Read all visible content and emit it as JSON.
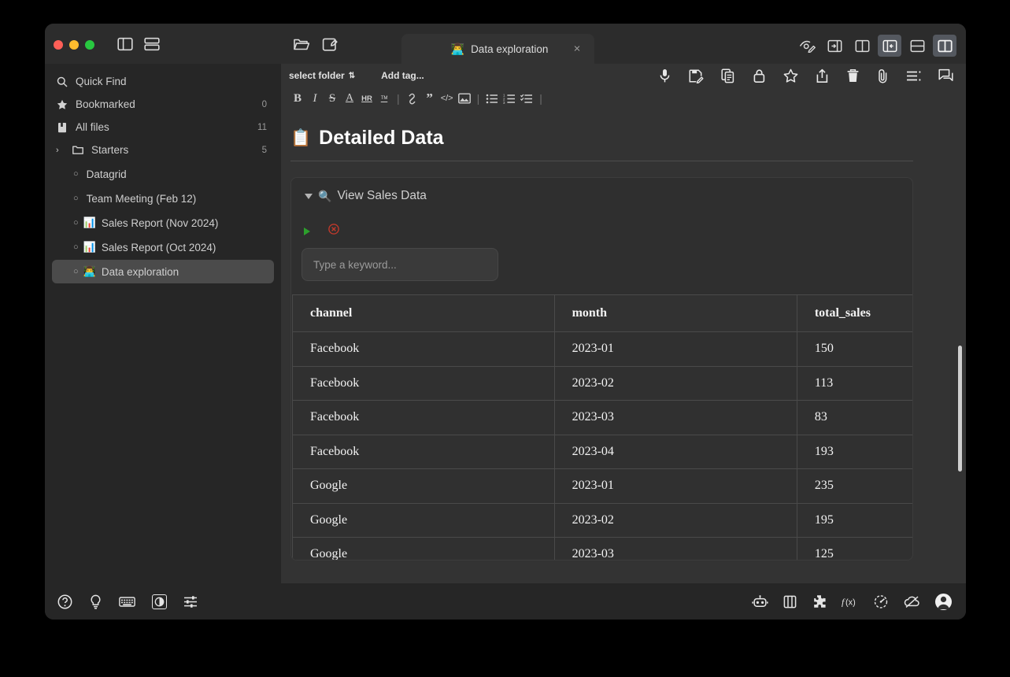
{
  "window": {
    "traffic_lights": [
      "close",
      "minimize",
      "maximize"
    ],
    "left_icons": [
      "sidebar-toggle-icon",
      "split-view-icon"
    ],
    "open_icons": [
      "open-folder-icon",
      "new-note-icon"
    ],
    "right_icons": [
      "preview-edit-icon",
      "focus-pane-icon",
      "dual-pane-icon",
      "left-pane-icon",
      "stacked-pane-icon",
      "side-pane-icon"
    ],
    "right_icons_active": [
      3,
      5
    ]
  },
  "tab": {
    "emoji": "👨‍💻",
    "title": "Data exploration",
    "close_label": "×"
  },
  "sidebar": {
    "quick_find": {
      "label": "Quick Find",
      "icon": "search-icon"
    },
    "bookmarked": {
      "label": "Bookmarked",
      "count": "0",
      "icon": "star-icon"
    },
    "all_files": {
      "label": "All files",
      "count": "11",
      "icon": "book-icon"
    },
    "folder": {
      "label": "Starters",
      "count": "5",
      "icon": "folder-icon",
      "chevron": "›"
    },
    "files": [
      {
        "bullet": "○",
        "emoji": "",
        "label": "Datagrid",
        "selected": false
      },
      {
        "bullet": "○",
        "emoji": "",
        "label": "Team Meeting (Feb 12)",
        "selected": false
      },
      {
        "bullet": "○",
        "emoji": "📊",
        "label": "Sales Report (Nov 2024)",
        "selected": false
      },
      {
        "bullet": "○",
        "emoji": "📊",
        "label": "Sales Report (Oct 2024)",
        "selected": false
      },
      {
        "bullet": "○",
        "emoji": "👨‍💻",
        "label": "Data exploration",
        "selected": true
      }
    ]
  },
  "meta": {
    "folder_label": "select folder",
    "folder_chevron": "⇅",
    "tag_label": "Add tag...",
    "doc_icons": [
      "microphone-icon",
      "save-edit-icon",
      "duplicate-icon",
      "lock-icon",
      "star-icon",
      "share-icon",
      "trash-icon",
      "attachment-icon",
      "outline-icon",
      "comment-icon"
    ]
  },
  "format_bar": {
    "items": [
      "bold",
      "italic",
      "strikethrough",
      "underline-a",
      "horizontal-rule",
      "highlight",
      "link",
      "quote",
      "code",
      "image",
      "bullet-list",
      "numbered-list",
      "task-list"
    ],
    "labels": {
      "bold": "B",
      "italic": "I",
      "strikethrough": "S",
      "underline_a": "A",
      "hr": "HR",
      "highlight": "ᵀᴹ",
      "quote": "”",
      "code": "</>"
    }
  },
  "document": {
    "title_emoji": "📋",
    "title": "Detailed Data",
    "block": {
      "toggle": "collapse-triangle",
      "head_emoji": "🔍",
      "head_label": "View Sales Data",
      "run_icon": "play-icon",
      "stop_icon": "cancel-icon",
      "input_value": "",
      "input_placeholder": "Type a keyword..."
    }
  },
  "table": {
    "columns": [
      "channel",
      "month",
      "total_sales"
    ],
    "rows": [
      [
        "Facebook",
        "2023-01",
        "150"
      ],
      [
        "Facebook",
        "2023-02",
        "113"
      ],
      [
        "Facebook",
        "2023-03",
        "83"
      ],
      [
        "Facebook",
        "2023-04",
        "193"
      ],
      [
        "Google",
        "2023-01",
        "235"
      ],
      [
        "Google",
        "2023-02",
        "195"
      ],
      [
        "Google",
        "2023-03",
        "125"
      ]
    ]
  },
  "statusbar": {
    "left_icons": [
      "help-icon",
      "lightbulb-icon",
      "keyboard-icon",
      "theme-contrast-icon",
      "settings-sliders-icon"
    ],
    "right_icons": [
      "robot-icon",
      "panel-icon",
      "plugin-icon",
      "function-icon",
      "performance-icon",
      "cloud-off-icon",
      "account-avatar-icon"
    ]
  },
  "colors": {
    "window_bg": "#2a2a2a",
    "sidebar_bg": "#262626",
    "editor_bg": "#333333",
    "block_bg": "#2f2f2f",
    "accent_active": "#54585f",
    "play_green": "#2ca02c",
    "stop_red": "#c0392b",
    "text_primary": "#f2f2f2",
    "text_muted": "#9a9a9a"
  }
}
